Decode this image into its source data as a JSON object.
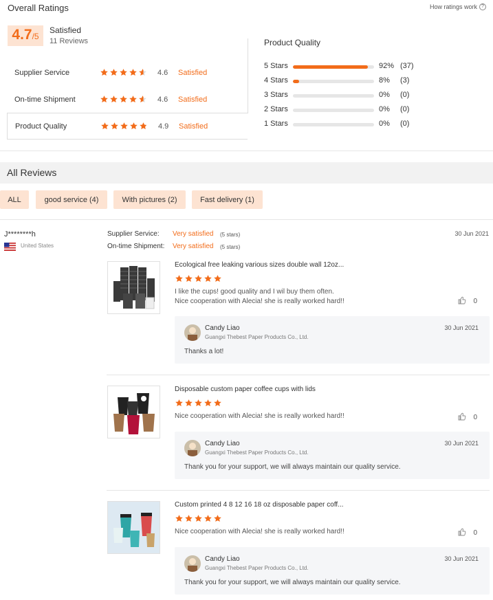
{
  "header": {
    "title": "Overall Ratings",
    "how_link": "How ratings work",
    "help_glyph": "?"
  },
  "summary": {
    "score": "4.7",
    "out_of": "/5",
    "label": "Satisfied",
    "reviews": "11 Reviews"
  },
  "categories": [
    {
      "label": "Supplier Service",
      "score": "4.6",
      "status": "Satisfied",
      "stars": 4.6
    },
    {
      "label": "On-time Shipment",
      "score": "4.6",
      "status": "Satisfied",
      "stars": 4.6
    },
    {
      "label": "Product Quality",
      "score": "4.9",
      "status": "Satisfied",
      "stars": 4.9
    }
  ],
  "product_quality": {
    "title": "Product Quality",
    "rows": [
      {
        "label": "5 Stars",
        "pct": "92%",
        "count": "(37)",
        "fill": 0.92
      },
      {
        "label": "4 Stars",
        "pct": "8%",
        "count": "(3)",
        "fill": 0.08
      },
      {
        "label": "3 Stars",
        "pct": "0%",
        "count": "(0)",
        "fill": 0
      },
      {
        "label": "2 Stars",
        "pct": "0%",
        "count": "(0)",
        "fill": 0
      },
      {
        "label": "1 Stars",
        "pct": "0%",
        "count": "(0)",
        "fill": 0
      }
    ]
  },
  "all_reviews": {
    "title": "All Reviews",
    "filters": [
      "ALL",
      "good service (4)",
      "With pictures (2)",
      "Fast delivery (1)"
    ]
  },
  "review": {
    "name": "J********h",
    "country": "United States",
    "date": "30 Jun 2021",
    "supplier_label": "Supplier Service:",
    "supplier_val": "Very satisfied",
    "supplier_stars": "(5 stars)",
    "shipment_label": "On-time Shipment:",
    "shipment_val": "Very satisfied",
    "shipment_stars": "(5 stars)",
    "items": [
      {
        "title": "Ecological free leaking various sizes double wall 12oz...",
        "text1": "I like the cups! good quality and I wil buy them often.",
        "text2": "Nice cooperation with Alecia! she is really worked hard!!",
        "likes": "0",
        "reply_name": "Candy Liao",
        "reply_company": "Guangxi Thebest Paper Products Co., Ltd.",
        "reply_date": "30 Jun 2021",
        "reply_text": "Thanks a lot!"
      },
      {
        "title": "Disposable custom paper coffee cups with lids",
        "text1": "Nice cooperation with Alecia! she is really worked hard!!",
        "text2": "",
        "likes": "0",
        "reply_name": "Candy Liao",
        "reply_company": "Guangxi Thebest Paper Products Co., Ltd.",
        "reply_date": "30 Jun 2021",
        "reply_text": "Thank you for your support, we will always maintain our quality service."
      },
      {
        "title": "Custom printed 4 8 12 16 18 oz disposable paper coff...",
        "text1": "Nice cooperation with Alecia! she is really worked hard!!",
        "text2": "",
        "likes": "0",
        "reply_name": "Candy Liao",
        "reply_company": "Guangxi Thebest Paper Products Co., Ltd.",
        "reply_date": "30 Jun 2021",
        "reply_text": "Thank you for your support, we will always maintain our quality service."
      }
    ]
  },
  "colors": {
    "accent": "#f26c1a",
    "chip_bg": "#fde3d2"
  }
}
